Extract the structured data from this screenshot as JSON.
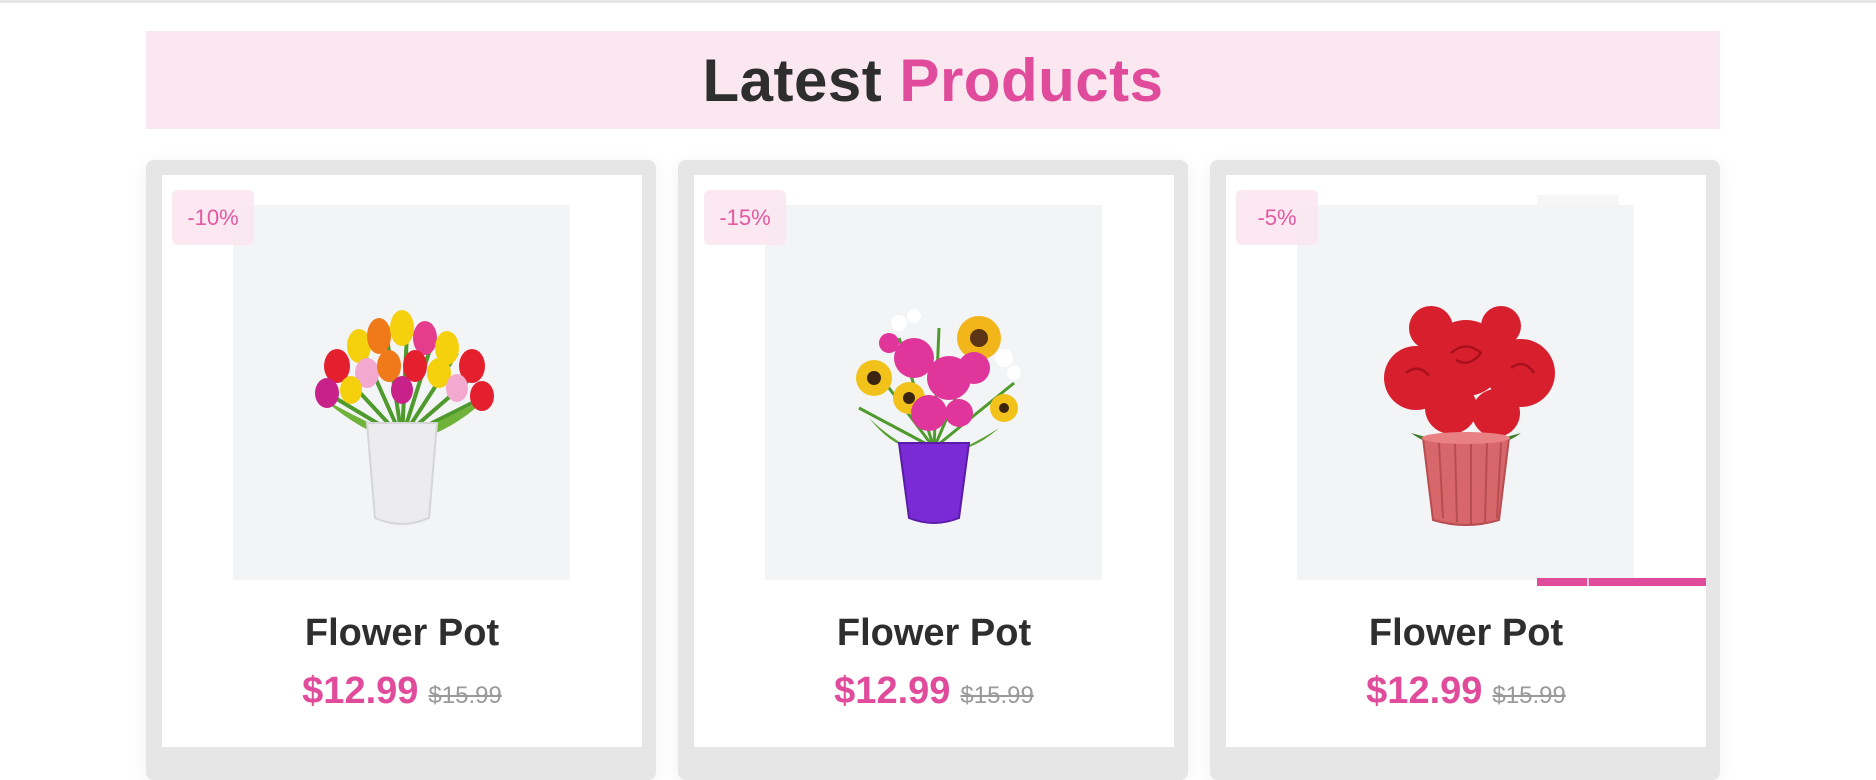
{
  "section": {
    "title_main": "Latest",
    "title_accent": "Products",
    "accent_color": "#e14b9b",
    "banner_color": "#fbe7f0"
  },
  "products": [
    {
      "discount": "-10%",
      "name": "Flower Pot",
      "price": "$12.99",
      "old_price": "$15.99",
      "image": "tulip-bouquet-white-vase"
    },
    {
      "discount": "-15%",
      "name": "Flower Pot",
      "price": "$12.99",
      "old_price": "$15.99",
      "image": "mixed-bouquet-purple-vase"
    },
    {
      "discount": "-5%",
      "name": "Flower Pot",
      "price": "$12.99",
      "old_price": "$15.99",
      "image": "red-roses-pink-pot"
    }
  ]
}
